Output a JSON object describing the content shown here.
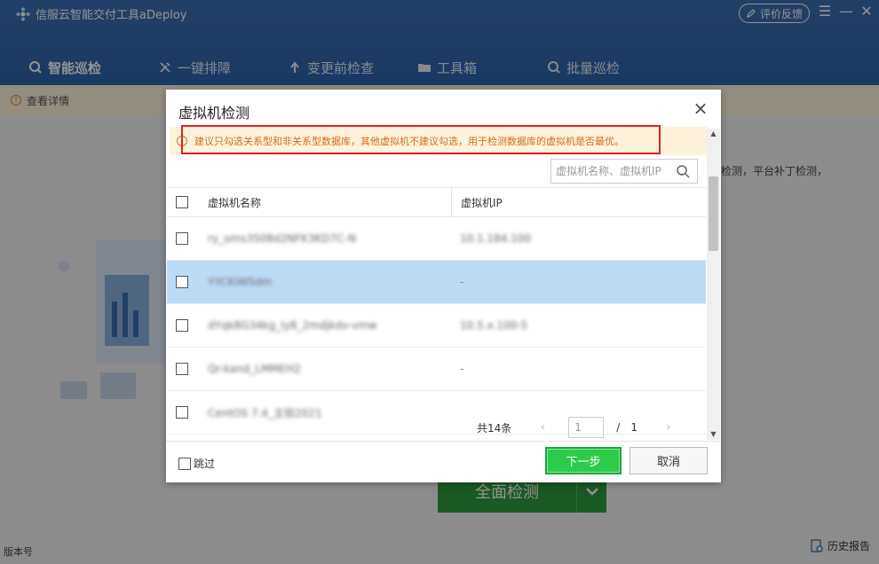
{
  "app": {
    "title": "信服云智能交付工具aDeploy",
    "feedback_label": "评价反馈",
    "menu_glyph": "☰",
    "minimize_glyph": "—",
    "close_glyph": "✕"
  },
  "tabs": [
    {
      "label": "智能巡检",
      "active": true
    },
    {
      "label": "一键排障"
    },
    {
      "label": "变更前检查"
    },
    {
      "label": "工具箱"
    },
    {
      "label": "批量巡检"
    }
  ],
  "notice": {
    "label": "查看详情"
  },
  "background": {
    "side_text": "检测，平台补丁检测，",
    "main_button_label": "全面检测",
    "version_label": "版本号",
    "history_label": "历史报告"
  },
  "dialog": {
    "title": "虚拟机检测",
    "warning": "建议只勾选关系型和非关系型数据库，其他虚拟机不建议勾选，用于检测数据库的虚拟机是否最优。",
    "search_placeholder": "虚拟机名称、虚拟机IP",
    "columns": {
      "name": "虚拟机名称",
      "ip": "虚拟机IP"
    },
    "rows": [
      {
        "name": "ry_oms3508d2NFK3KD7C-N",
        "ip": "10.1.184.100"
      },
      {
        "name": "YYCKiW5dm",
        "ip": "-"
      },
      {
        "name": "dYqk8G34kg_ly8_2mdjkdv-vmw",
        "ip": "10.5.x.100-5"
      },
      {
        "name": "Qr-kand_LMMEH2",
        "ip": "-"
      },
      {
        "name": "CentOS 7.4_主验2021",
        "ip": ""
      }
    ],
    "pager": {
      "total": "共14条",
      "page": "1",
      "separator": "/",
      "pages": "1",
      "prev": "‹",
      "next": "›"
    },
    "skip_label": "跳过",
    "next_label": "下一步",
    "cancel_label": "取消"
  },
  "colors": {
    "header": "#2d64ad",
    "primary_green": "#2ecb4b",
    "warning_orange": "#d46b1e",
    "selected_row": "#bcdcf6",
    "highlight_red": "#e02020"
  }
}
